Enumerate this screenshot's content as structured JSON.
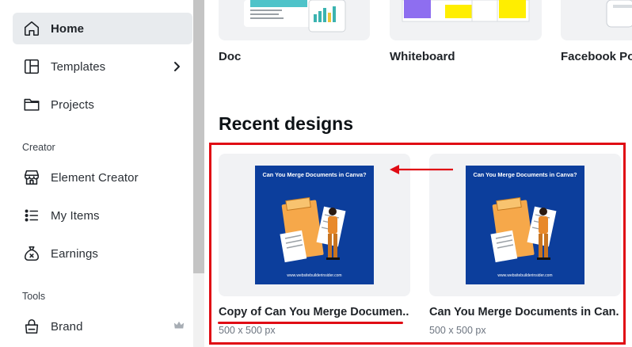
{
  "sidebar": {
    "items": [
      {
        "label": "Home",
        "icon": "home-icon"
      },
      {
        "label": "Templates",
        "icon": "templates-icon"
      },
      {
        "label": "Projects",
        "icon": "folder-icon"
      },
      {
        "label": "Element Creator",
        "icon": "store-icon"
      },
      {
        "label": "My Items",
        "icon": "list-icon"
      },
      {
        "label": "Earnings",
        "icon": "money-bag-icon"
      },
      {
        "label": "Brand",
        "icon": "brand-icon"
      }
    ],
    "sections": {
      "creator": "Creator",
      "tools": "Tools"
    }
  },
  "top_cards": [
    {
      "label": "Doc"
    },
    {
      "label": "Whiteboard"
    },
    {
      "label": "Facebook Pos"
    }
  ],
  "recent": {
    "heading": "Recent designs",
    "designs": [
      {
        "title": "Copy of Can You Merge Documen...",
        "size": "500 x 500 px",
        "image_title": "Can You Merge Documents in Canva?",
        "image_url": "www.websitebuilderinsider.com"
      },
      {
        "title": "Can You Merge Documents in Can...",
        "size": "500 x 500 px",
        "image_title": "Can You Merge Documents in Canva?",
        "image_url": "www.websitebuilderinsider.com"
      }
    ]
  },
  "colors": {
    "active_bg": "#e8ebee",
    "annotation_red": "#e00b14",
    "design_blue": "#0c3e9c"
  }
}
